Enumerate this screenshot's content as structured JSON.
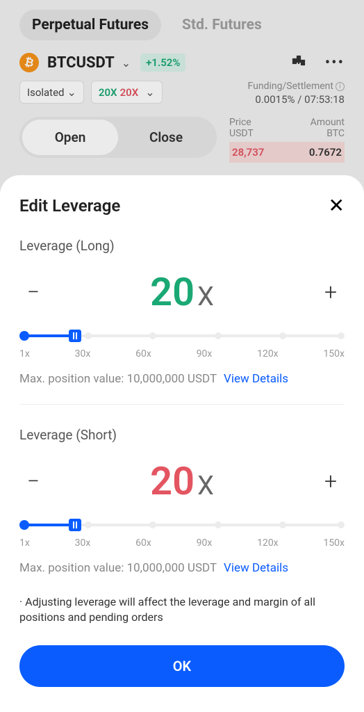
{
  "tabs": {
    "perpetual": "Perpetual Futures",
    "standard": "Std. Futures"
  },
  "pair": {
    "symbol": "BTCUSDT",
    "change_pct": "+1.52%"
  },
  "margin_mode": "Isolated",
  "lev_display": {
    "long": "20X",
    "short": "20X"
  },
  "funding": {
    "label": "Funding/Settlement",
    "value": "0.0015% / 07:53:18"
  },
  "oc": {
    "open": "Open",
    "close": "Close"
  },
  "orderbook": {
    "price_label": "Price",
    "price_unit": "USDT",
    "amount_label": "Amount",
    "amount_unit": "BTC",
    "row": {
      "price": "28,737",
      "amount": "0.7672"
    }
  },
  "modal": {
    "title": "Edit Leverage",
    "close": "✕",
    "long_label": "Leverage (Long)",
    "short_label": "Leverage (Short)",
    "minus": "−",
    "plus": "+",
    "long_value": "20",
    "short_value": "20",
    "x": "X",
    "ticks": [
      "1x",
      "30x",
      "60x",
      "90x",
      "120x",
      "150x"
    ],
    "slider_pos_pct": 13,
    "maxpos_prefix": "Max. position value: ",
    "maxpos_value": "10,000,000 USDT",
    "view_details": "View Details",
    "note": "·  Adjusting leverage will affect the leverage and margin of all positions and pending orders",
    "ok": "OK"
  }
}
